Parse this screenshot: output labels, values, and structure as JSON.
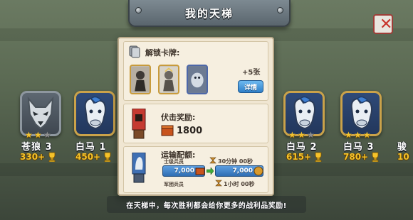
{
  "header": {
    "title": "我的天梯"
  },
  "arenas": [
    {
      "id": "wolf",
      "name": "苍狼 3",
      "trophy": "330+",
      "stars": 2
    },
    {
      "id": "horse1",
      "name": "白马 1",
      "trophy": "450+",
      "stars": 0
    },
    {
      "id": "horse2",
      "name": "白马 2",
      "trophy": "615+",
      "stars": 2
    },
    {
      "id": "horse3",
      "name": "白马 3",
      "trophy": "780+",
      "stars": 3
    },
    {
      "id": "next",
      "name": "骏",
      "trophy": "10"
    }
  ],
  "center": {
    "unlock": {
      "title": "解锁卡牌:",
      "count": "+5张",
      "detail_button": "详情"
    },
    "reward": {
      "title": "伏击奖励:",
      "amount": "1800"
    },
    "transport": {
      "title": "运输配额:",
      "row1_label": "士级兵员",
      "row1_time": "30分钟  00秒",
      "bar_left": "7,000",
      "bar_right": "7,000",
      "row2_label": "军团兵员",
      "row2_time": "1小时  00秒"
    }
  },
  "footer": {
    "text": "在天梯中，每次胜利都会给你更多的战利品奖励!"
  },
  "colors": {
    "accent": "#f5c32a",
    "button": "#2f7fc8",
    "panel": "#f0e6d2"
  }
}
